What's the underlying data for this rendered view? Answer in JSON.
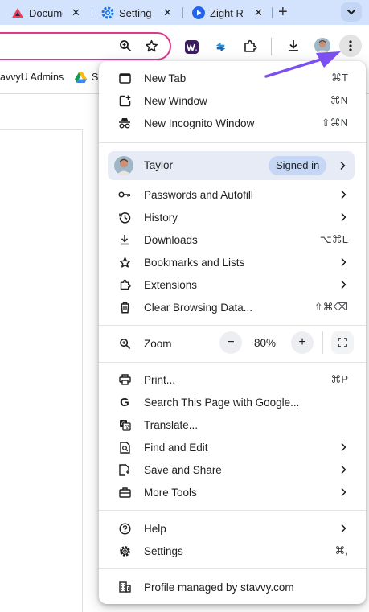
{
  "tabs": [
    {
      "title": "Docume",
      "icon": "stavvy-logo-icon"
    },
    {
      "title": "Setting",
      "icon": "settings-gear-icon"
    },
    {
      "title": "Zight R",
      "icon": "zight-logo-icon"
    }
  ],
  "bookmarks": [
    {
      "label": "avvyU Admins"
    },
    {
      "label": "S",
      "icon": "google-drive-icon"
    }
  ],
  "menu": {
    "new_tab": {
      "label": "New Tab",
      "shortcut": "⌘T"
    },
    "new_window": {
      "label": "New Window",
      "shortcut": "⌘N"
    },
    "new_incognito": {
      "label": "New Incognito Window",
      "shortcut": "⇧⌘N"
    },
    "profile": {
      "name": "Taylor",
      "status": "Signed in"
    },
    "passwords": {
      "label": "Passwords and Autofill"
    },
    "history": {
      "label": "History"
    },
    "downloads": {
      "label": "Downloads",
      "shortcut": "⌥⌘L"
    },
    "bookmarks": {
      "label": "Bookmarks and Lists"
    },
    "extensions": {
      "label": "Extensions"
    },
    "clear_data": {
      "label": "Clear Browsing Data...",
      "shortcut": "⇧⌘⌫"
    },
    "zoom": {
      "label": "Zoom",
      "minus": "−",
      "value": "80%",
      "plus": "+"
    },
    "print": {
      "label": "Print...",
      "shortcut": "⌘P"
    },
    "search_page": {
      "label": "Search This Page with Google..."
    },
    "translate": {
      "label": "Translate..."
    },
    "find_edit": {
      "label": "Find and Edit"
    },
    "save_share": {
      "label": "Save and Share"
    },
    "more_tools": {
      "label": "More Tools"
    },
    "help": {
      "label": "Help"
    },
    "settings": {
      "label": "Settings",
      "shortcut": "⌘,"
    },
    "managed": {
      "label": "Profile managed by stavvy.com"
    }
  },
  "colors": {
    "tabstrip": "#d3e3fd",
    "omnibox_border": "#d93a8b",
    "profile_bg": "#e6ebf5",
    "annotation_arrow": "#7b4ff0"
  }
}
